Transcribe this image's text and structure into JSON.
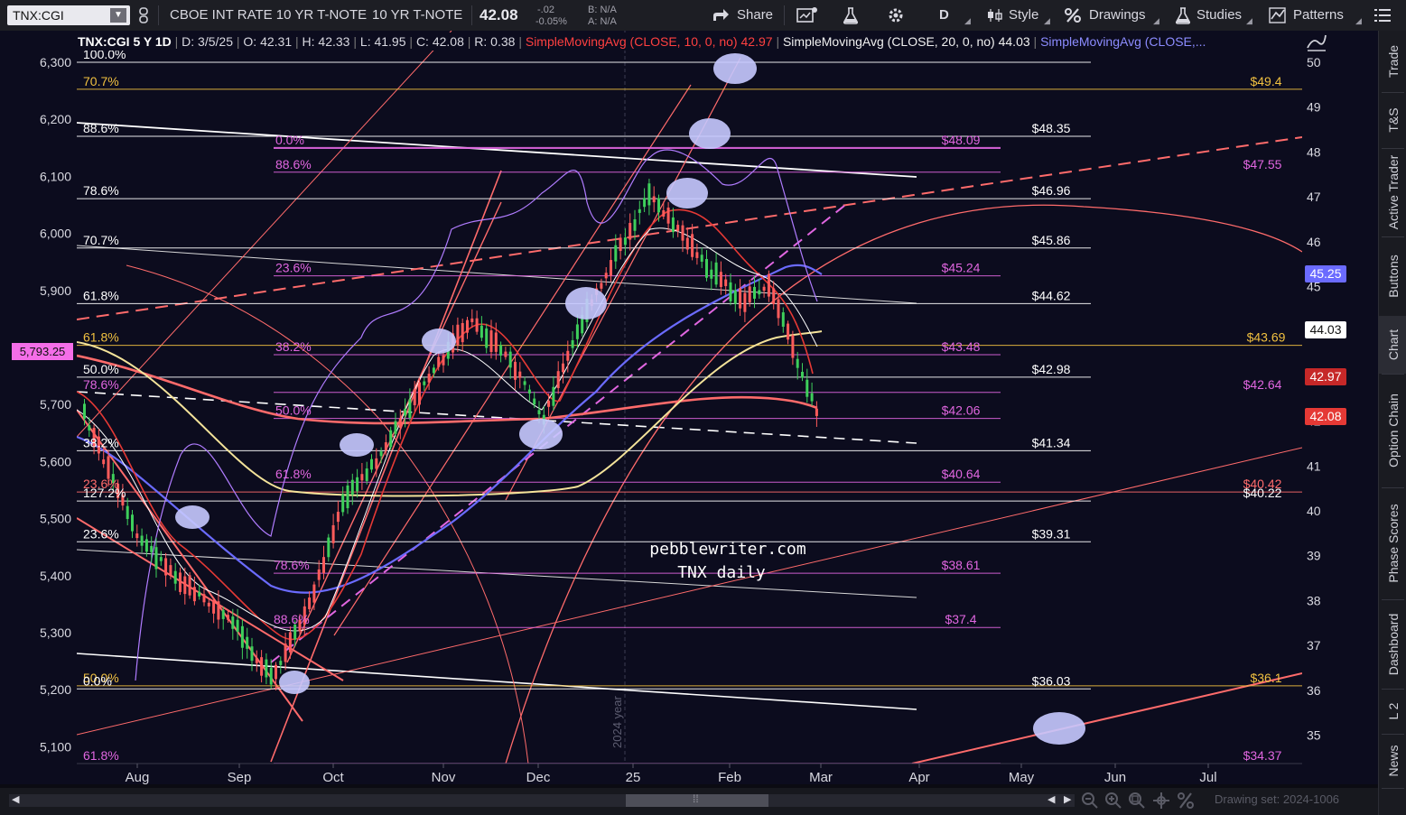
{
  "toolbar": {
    "symbol": "TNX:CGI",
    "description1": "CBOE INT RATE 10 YR T-NOTE",
    "description2": "10 YR T-NOTE",
    "last": "42.08",
    "change": "-.02",
    "change_pct": "-0.05%",
    "bid": "B: N/A",
    "ask": "A: N/A",
    "share": "Share",
    "aggregation": "D",
    "style": "Style",
    "drawings": "Drawings",
    "studies": "Studies",
    "patterns": "Patterns"
  },
  "header": {
    "title": "TNX:CGI 5 Y 1D",
    "date": "D: 3/5/25",
    "open": "O: 42.31",
    "high": "H: 42.33",
    "low": "L: 41.95",
    "close": "C: 42.08",
    "range": "R: 0.38",
    "sma10_label": "SimpleMovingAvg (CLOSE, 10, 0, no)",
    "sma10_value": "42.97",
    "sma20_label": "SimpleMovingAvg (CLOSE, 20, 0, no)",
    "sma20_value": "44.03",
    "sma_third_label": "SimpleMovingAvg (CLOSE,..."
  },
  "colors": {
    "background": "#0c0c1e",
    "sma10": "#e53935",
    "sma20": "#f5f5f5",
    "sma_blue": "#6b6bff",
    "sma_yellow": "#f4e39a",
    "price_up": "#3ecf5b",
    "price_down": "#ff5b5b",
    "fib_magenta": "#e066e0",
    "fib_yellow": "#f0c040"
  },
  "chart_data": {
    "type": "candlestick",
    "x_labels": [
      "Aug",
      "Sep",
      "Oct",
      "Nov",
      "Dec",
      "25",
      "Feb",
      "Mar",
      "Apr",
      "May",
      "Jun",
      "Jul"
    ],
    "right_axis_ticks": [
      50,
      49,
      48,
      47,
      46,
      45,
      44,
      43,
      42,
      41,
      40,
      39,
      38,
      37,
      36,
      35
    ],
    "left_axis_ticks": [
      "6,300",
      "6,200",
      "6,100",
      "6,000",
      "5,900",
      "5,800",
      "5,700",
      "5,600",
      "5,500",
      "5,400",
      "5,300",
      "5,200",
      "5,100"
    ],
    "left_badge": "5,793.25",
    "right_badges": [
      {
        "value": "45.25",
        "bg": "#6b6bff",
        "fg": "#ffffff"
      },
      {
        "value": "44.03",
        "bg": "#ffffff",
        "fg": "#111111"
      },
      {
        "value": "42.97",
        "bg": "#c62828",
        "fg": "#ffffff"
      },
      {
        "value": "42.08",
        "bg": "#e53935",
        "fg": "#ffffff"
      }
    ],
    "level_lines": [
      {
        "value": 50.0,
        "label": "100.0%",
        "color": "#ffffff"
      },
      {
        "value": 49.4,
        "label": "70.7%",
        "color": "#f0c040",
        "right": "$49.4"
      },
      {
        "value": 48.35,
        "label": "88.6%",
        "color": "#ffffff",
        "right": "$48.35"
      },
      {
        "value": 48.09,
        "label": "0.0%",
        "color": "#e066e0",
        "right": "$48.09"
      },
      {
        "value": 47.55,
        "label": "88.6%",
        "color": "#e066e0",
        "right": "$47.55"
      },
      {
        "value": 46.96,
        "label": "78.6%",
        "color": "#ffffff",
        "right": "$46.96"
      },
      {
        "value": 45.86,
        "label": "70.7%",
        "color": "#ffffff",
        "right": "$45.86"
      },
      {
        "value": 45.24,
        "label": "23.6%",
        "color": "#e066e0",
        "right": "$45.24"
      },
      {
        "value": 44.62,
        "label": "61.8%",
        "color": "#ffffff",
        "right": "$44.62"
      },
      {
        "value": 43.69,
        "label": "61.8%",
        "color": "#f0c040",
        "right": "$43.69"
      },
      {
        "value": 43.48,
        "label": "38.2%",
        "color": "#e066e0",
        "right": "$43.48"
      },
      {
        "value": 42.98,
        "label": "50.0%",
        "color": "#ffffff",
        "right": "$42.98"
      },
      {
        "value": 42.64,
        "label": "78.6%",
        "color": "#e066e0",
        "right": "$42.64"
      },
      {
        "value": 42.06,
        "label": "50.0%",
        "color": "#e066e0",
        "right": "$42.06"
      },
      {
        "value": 41.34,
        "label": "38.2%",
        "color": "#ffffff",
        "right": "$41.34"
      },
      {
        "value": 40.64,
        "label": "61.8%",
        "color": "#e066e0",
        "right": "$40.64"
      },
      {
        "value": 40.42,
        "label": "23.6%",
        "color": "#ff6b6b",
        "right": "$40.42"
      },
      {
        "value": 40.22,
        "label": "127.2%",
        "color": "#ffffff",
        "right": "$40.22"
      },
      {
        "value": 39.31,
        "label": "23.6%",
        "color": "#ffffff",
        "right": "$39.31"
      },
      {
        "value": 38.61,
        "label": "78.6%",
        "color": "#e066e0",
        "right": "$38.61"
      },
      {
        "value": 37.4,
        "label": "88.6%",
        "color": "#e066e0",
        "right": "$37.4"
      },
      {
        "value": 36.1,
        "label": "50.0%",
        "color": "#f0c040",
        "right": "$36.1"
      },
      {
        "value": 36.03,
        "label": "0.0%",
        "color": "#ffffff",
        "right": "$36.03"
      },
      {
        "value": 34.37,
        "label": "61.8%",
        "color": "#e066e0",
        "right": "$34.37"
      }
    ],
    "watermark_line1": "pebblewriter.com",
    "watermark_line2": "TNX daily",
    "year_marker": "2024 year"
  },
  "rail": {
    "tabs": [
      "Trade",
      "T&S",
      "Active Trader",
      "Buttons",
      "Chart",
      "Option Chain",
      "Phase Scores",
      "Dashboard",
      "L 2",
      "News"
    ]
  },
  "footer": {
    "drawing_set": "Drawing set: 2024-1006"
  }
}
